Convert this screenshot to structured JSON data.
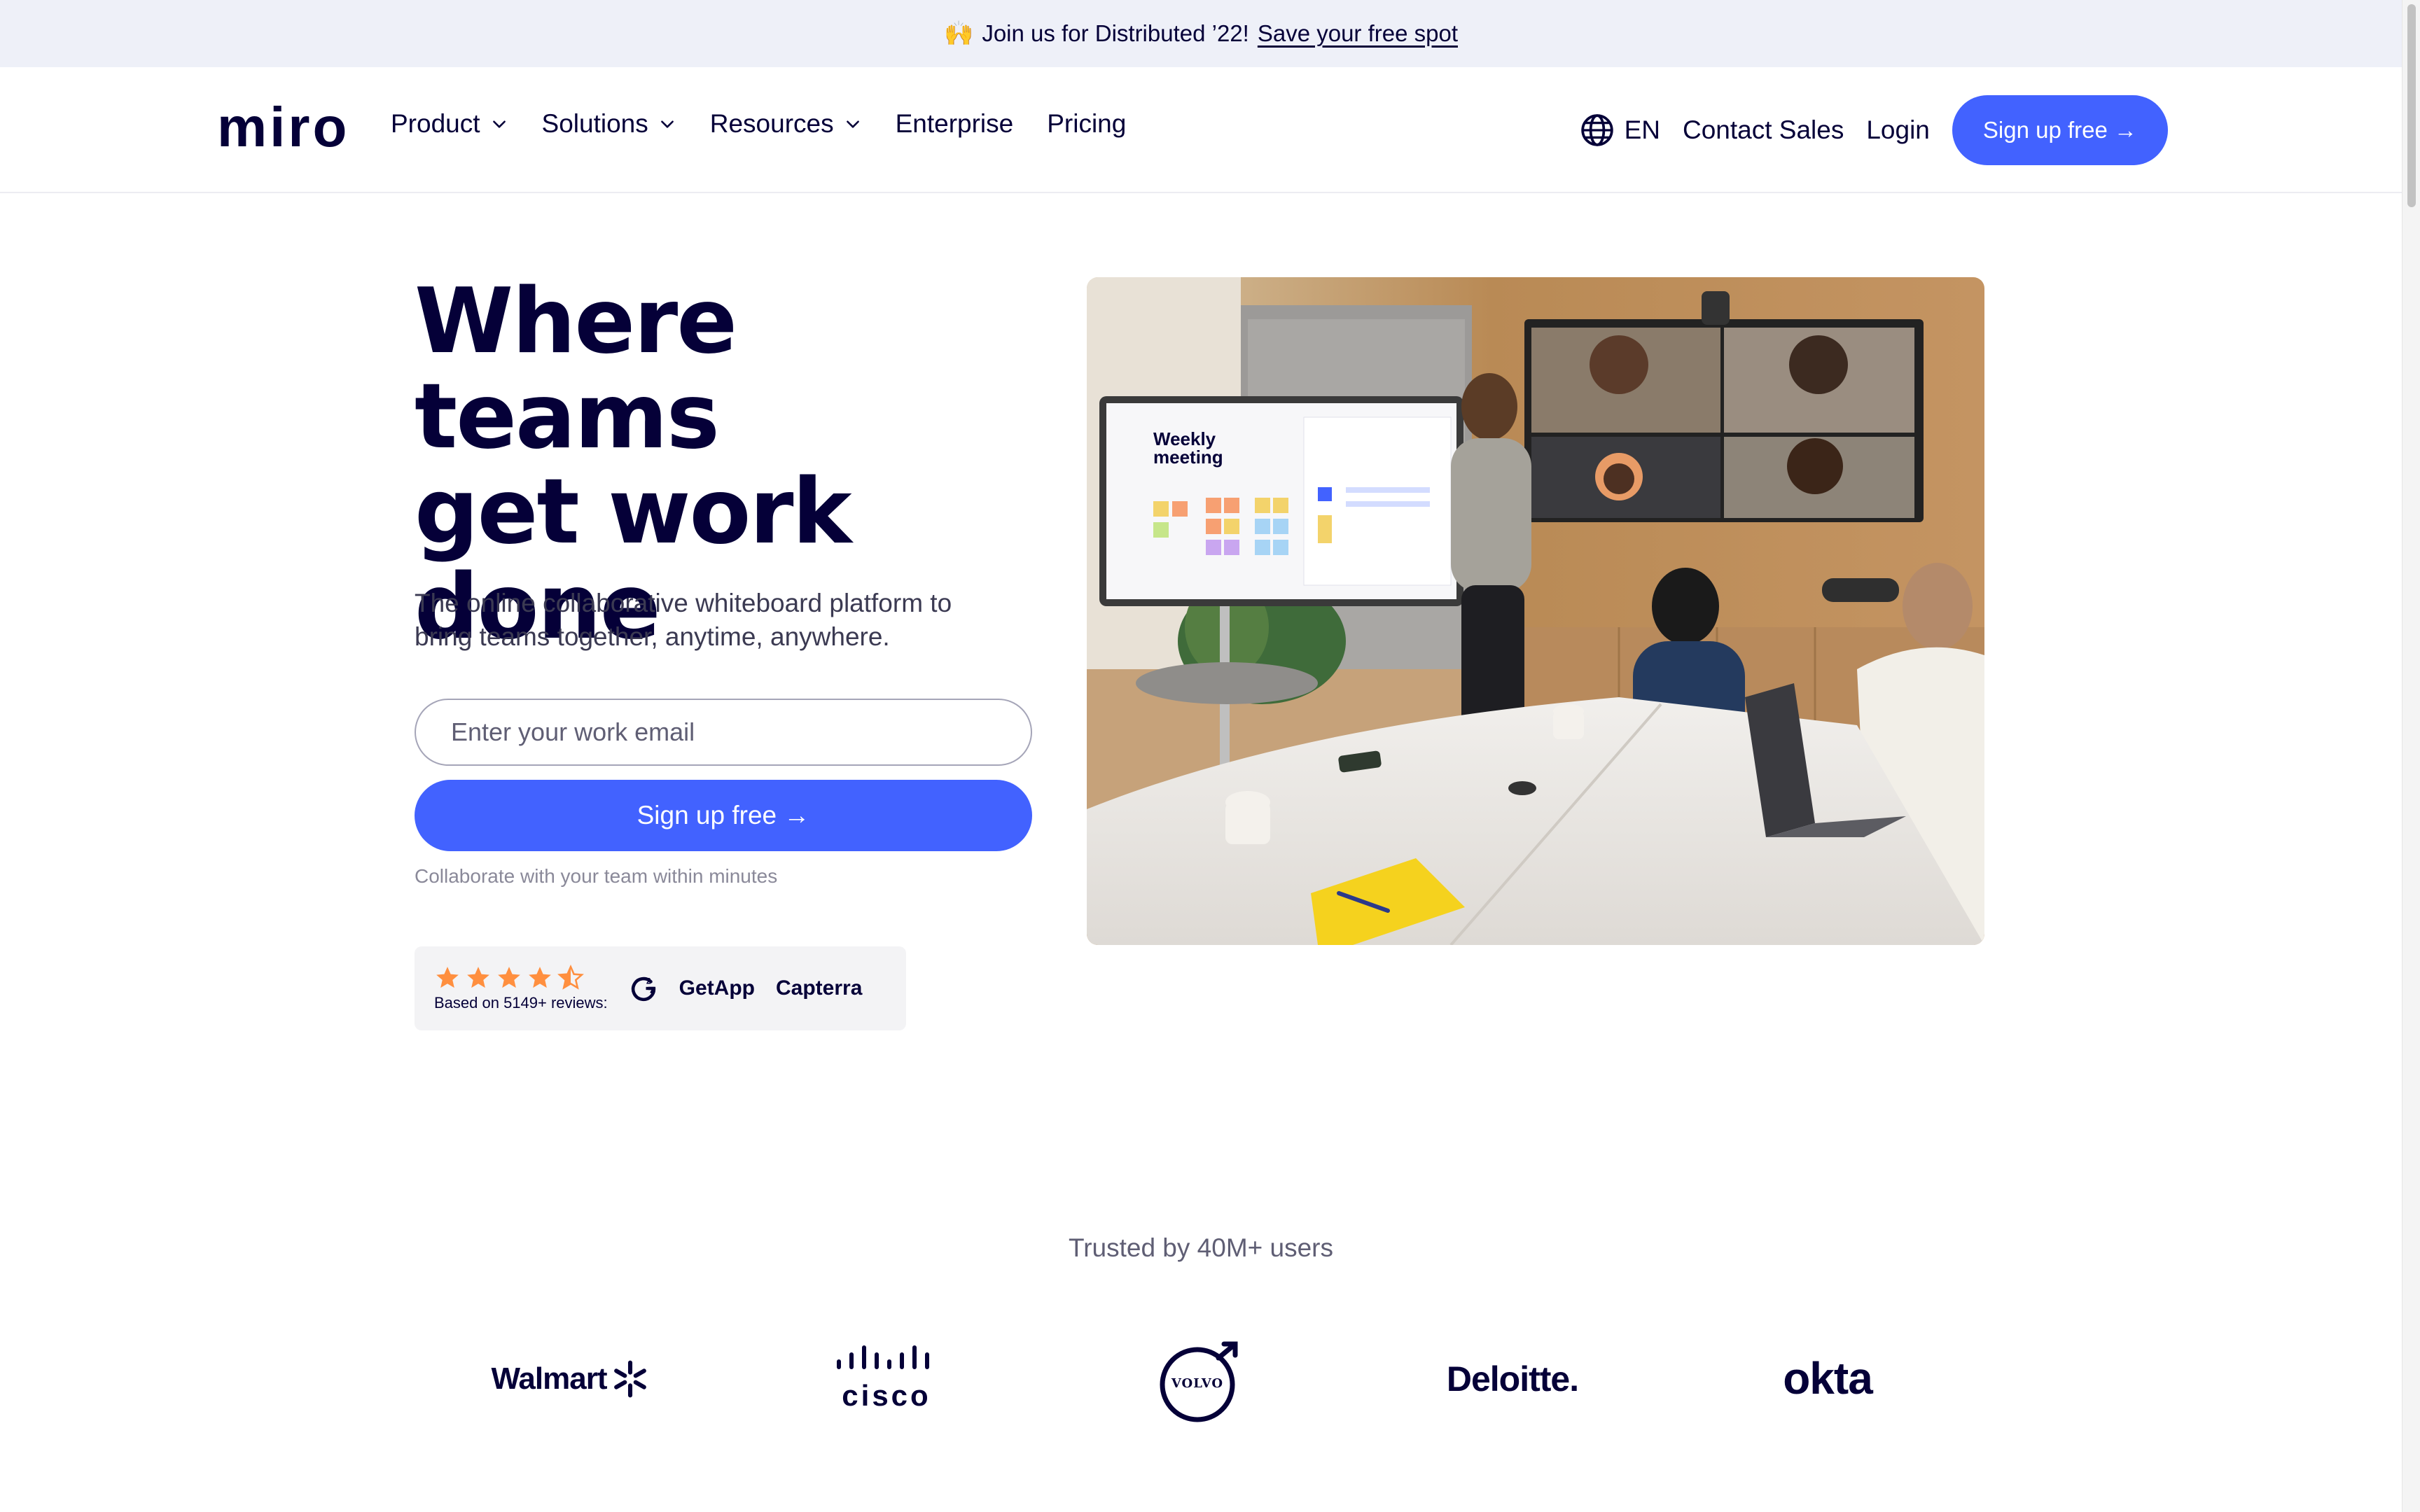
{
  "banner": {
    "emoji": "🙌",
    "text": "Join us for Distributed ’22!",
    "link": "Save your free spot"
  },
  "nav": {
    "logo": "miro",
    "menu": [
      {
        "label": "Product",
        "dropdown": true
      },
      {
        "label": "Solutions",
        "dropdown": true
      },
      {
        "label": "Resources",
        "dropdown": true
      },
      {
        "label": "Enterprise",
        "dropdown": false
      },
      {
        "label": "Pricing",
        "dropdown": false
      }
    ],
    "language": "EN",
    "contact": "Contact Sales",
    "login": "Login",
    "signup": "Sign up free →"
  },
  "hero": {
    "title_lines": [
      "Where teams",
      "get work",
      "done"
    ],
    "subtitle_lines": [
      "The online collaborative whiteboard platform to",
      "bring teams together, anytime, anywhere."
    ],
    "email_placeholder": "Enter your work email",
    "signup": "Sign up free →",
    "note": "Collaborate with your team within minutes",
    "rating": 4.5,
    "reviews_text": "Based on 5149+ reviews:",
    "review_sites": [
      "GetApp",
      "Capterra"
    ]
  },
  "screen": {
    "title_lines": [
      "Weekly",
      "meeting"
    ]
  },
  "trusted": {
    "text": "Trusted by 40M+ users",
    "brands": [
      "Walmart",
      "cisco",
      "VOLVO",
      "Deloitte.",
      "okta"
    ]
  },
  "colors": {
    "accent": "#4262ff",
    "ink": "#050038",
    "banner_bg": "#eef0f8",
    "star": "#ff8f3f"
  }
}
